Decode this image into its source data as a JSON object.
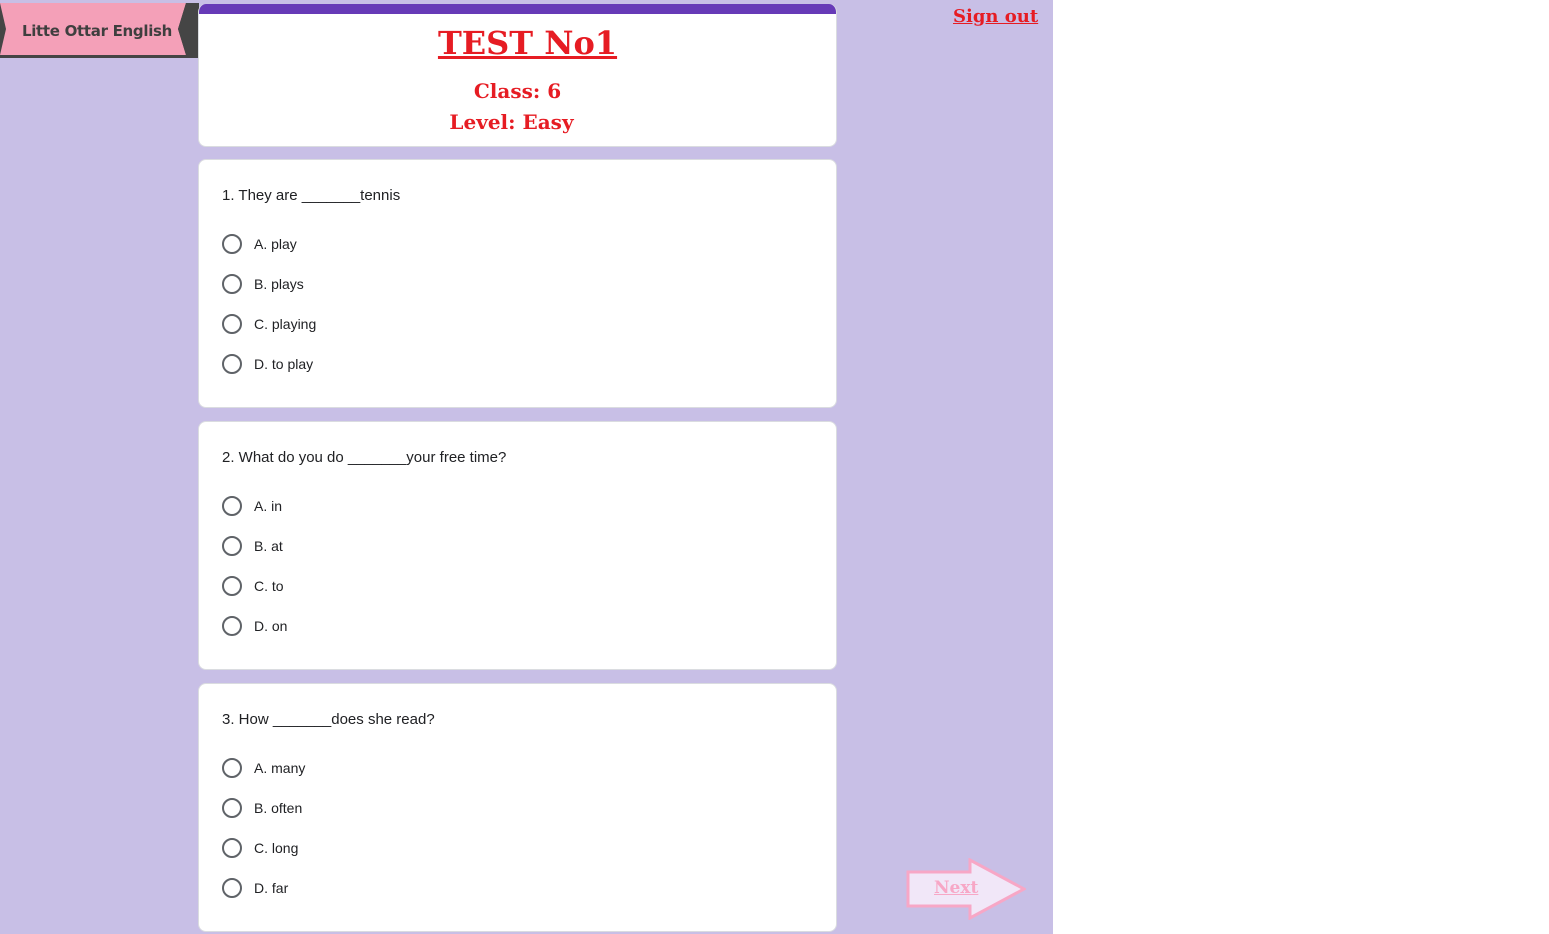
{
  "brand": {
    "name": "Litte Ottar English"
  },
  "header": {
    "title": "TEST No1",
    "class_line": "Class: 6",
    "level_line": "Level: Easy",
    "sign_out_label": "Sign out"
  },
  "colors": {
    "background": "#c8bfe6",
    "accent_bar": "#673ab7",
    "title_red": "#e61c23",
    "ribbon_pink": "#f4a0b8",
    "next_pink": "#f7a7c6"
  },
  "questions": [
    {
      "text": "1. They are _______tennis",
      "options": [
        "A. play",
        "B. plays",
        "C. playing",
        "D. to play"
      ]
    },
    {
      "text": "2. What do you do _______your free time?",
      "options": [
        "A. in",
        "B. at",
        "C. to",
        "D. on"
      ]
    },
    {
      "text": "3. How _______does she read?",
      "options": [
        "A. many",
        "B. often",
        "C. long",
        "D. far"
      ]
    }
  ],
  "navigation": {
    "next_label": "Next"
  }
}
